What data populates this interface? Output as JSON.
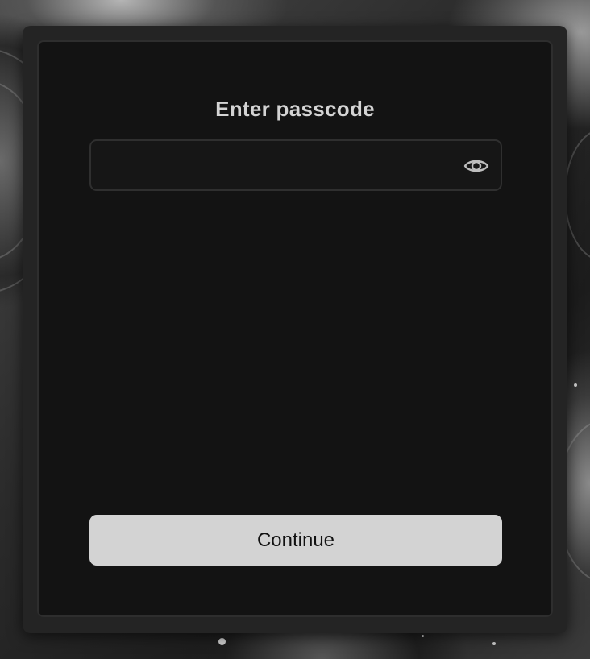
{
  "dialog": {
    "title": "Enter passcode",
    "passcode_value": "",
    "passcode_placeholder": "",
    "visibility_icon": "eye-icon",
    "continue_label": "Continue"
  },
  "colors": {
    "dialog_background": "#131313",
    "panel_background": "#242424",
    "field_border": "#2f2f2f",
    "title_text": "#d4d4d4",
    "button_background": "#d3d3d3",
    "button_text": "#111111",
    "icon_color": "#bdbdbd"
  }
}
